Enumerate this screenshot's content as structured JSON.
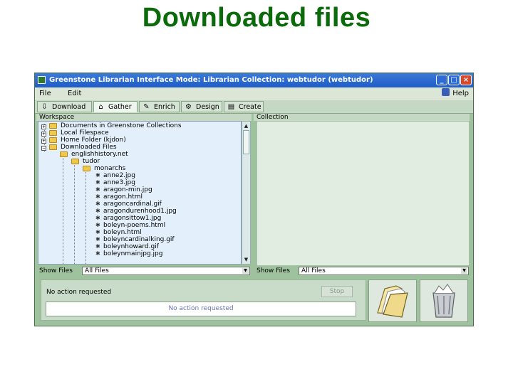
{
  "slide": {
    "title": "Downloaded files"
  },
  "window": {
    "title": "Greenstone Librarian Interface  Mode: Librarian  Collection: webtudor (webtudor)",
    "controls": {
      "minimize": "_",
      "maximize": "□",
      "close": "×"
    }
  },
  "menu": {
    "file": "File",
    "edit": "Edit",
    "help": "Help"
  },
  "tabs": [
    {
      "label": "Download",
      "icon": "download-icon"
    },
    {
      "label": "Gather",
      "icon": "gather-icon"
    },
    {
      "label": "Enrich",
      "icon": "enrich-icon"
    },
    {
      "label": "Design",
      "icon": "design-gear-icon"
    },
    {
      "label": "Create",
      "icon": "create-icon"
    }
  ],
  "active_tab": "Gather",
  "workspace": {
    "header": "Workspace",
    "tree": [
      "Documents in Greenstone Collections",
      "Local Filespace",
      "Home Folder (kjdon)",
      "Downloaded Files",
      "englishhistory.net",
      "tudor",
      "monarchs",
      "anne2.jpg",
      "anne3.jpg",
      "aragon-min.jpg",
      "aragon.html",
      "aragoncardinal.gif",
      "aragondurenhood1.jpg",
      "aragonsittow1.jpg",
      "boleyn-poems.html",
      "boleyn.html",
      "boleyncardinalking.gif",
      "boleynhoward.gif",
      "boleynmainjpg.jpg"
    ],
    "show_files_label": "Show Files",
    "show_files_value": "All Files"
  },
  "collection": {
    "header": "Collection",
    "show_files_label": "Show Files",
    "show_files_value": "All Files"
  },
  "status": {
    "message": "No action requested",
    "stop_label": "Stop",
    "progress_text": "No action requested"
  },
  "colors": {
    "title_green": "#0b6b0b",
    "window_bg": "#9ec29e",
    "titlebar_blue": "#1f5cc6"
  }
}
